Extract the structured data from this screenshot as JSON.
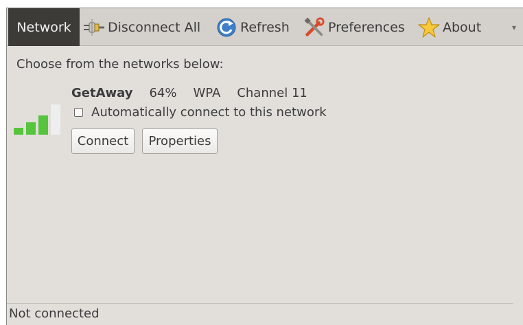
{
  "toolbar": {
    "network": {
      "label": "Network",
      "icon": "none"
    },
    "disconnect_all": {
      "label": "Disconnect All",
      "icon": "plug-icon"
    },
    "refresh": {
      "label": "Refresh",
      "icon": "refresh-icon"
    },
    "preferences": {
      "label": "Preferences",
      "icon": "tools-icon"
    },
    "about": {
      "label": "About",
      "icon": "star-icon"
    },
    "overflow": {
      "label": "▾",
      "icon": "chevron-down-icon"
    }
  },
  "main": {
    "prompt": "Choose from the networks below:",
    "network": {
      "name": "GetAway",
      "strength": "64%",
      "strength_fraction": 0.64,
      "security": "WPA",
      "channel": "Channel 11",
      "auto_connect_label": "Automatically connect to this network",
      "auto_connect_checked": false,
      "connect_label": "Connect",
      "properties_label": "Properties"
    }
  },
  "status_bar": {
    "text": "Not connected"
  },
  "colors": {
    "toolbar_active_bg": "#3c3b37",
    "window_bg": "#e2dfdb",
    "signal_green": "#56c43c",
    "signal_empty": "#eeeeee"
  }
}
